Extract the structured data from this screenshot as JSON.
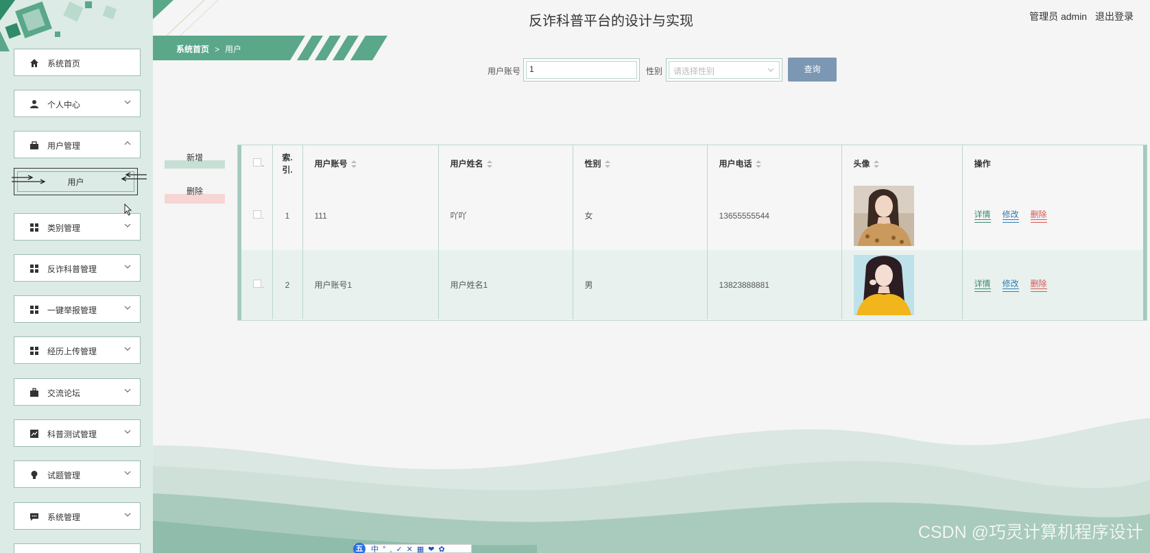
{
  "header": {
    "title": "反诈科普平台的设计与实现",
    "user_role": "管理员 admin",
    "logout": "退出登录"
  },
  "breadcrumb": {
    "home": "系统首页",
    "separator": ">",
    "current": "用户"
  },
  "sidebar": {
    "items": [
      {
        "label": "系统首页",
        "icon": "home-icon"
      },
      {
        "label": "个人中心",
        "icon": "person-icon"
      },
      {
        "label": "用户管理",
        "icon": "user-manage-icon"
      },
      {
        "label": "类别管理",
        "icon": "grid-icon"
      },
      {
        "label": "反诈科普管理",
        "icon": "grid-icon"
      },
      {
        "label": "一键举报管理",
        "icon": "grid-icon"
      },
      {
        "label": "经历上传管理",
        "icon": "grid-icon"
      },
      {
        "label": "交流论坛",
        "icon": "briefcase-icon"
      },
      {
        "label": "科普测试管理",
        "icon": "chart-icon"
      },
      {
        "label": "试题管理",
        "icon": "bulb-icon"
      },
      {
        "label": "系统管理",
        "icon": "message-icon"
      }
    ],
    "submenu_label": "用户"
  },
  "search": {
    "account_label": "用户账号",
    "account_value": "1",
    "gender_label": "性别",
    "gender_placeholder": "请选择性别",
    "query_button": "查询"
  },
  "actions": {
    "add": "新增",
    "delete": "删除"
  },
  "table": {
    "headers": {
      "index": "索引",
      "index_line1": "索.",
      "index_line2": "引.",
      "account": "用户账号",
      "name": "用户姓名",
      "gender": "性别",
      "phone": "用户电话",
      "avatar": "头像",
      "ops": "操作"
    },
    "rows": [
      {
        "index": "1",
        "account": "111",
        "name": "吖吖",
        "gender": "女",
        "phone": "13655555544"
      },
      {
        "index": "2",
        "account": "用户账号1",
        "name": "用户姓名1",
        "gender": "男",
        "phone": "13823888881"
      }
    ],
    "op_labels": {
      "detail": "详情",
      "edit": "修改",
      "delete": "删除"
    }
  },
  "ime": {
    "logo": "五",
    "tools": "中°,✓✕▦❤✿"
  },
  "watermark": "CSDN @巧灵计算机程序设计",
  "colors": {
    "sidebar_bg": "#dcebe5",
    "accent": "#5aa78a",
    "query_button": "#7c97b3",
    "detail": "#3c8a70",
    "edit": "#2f7ab5",
    "delete": "#d9534f"
  }
}
